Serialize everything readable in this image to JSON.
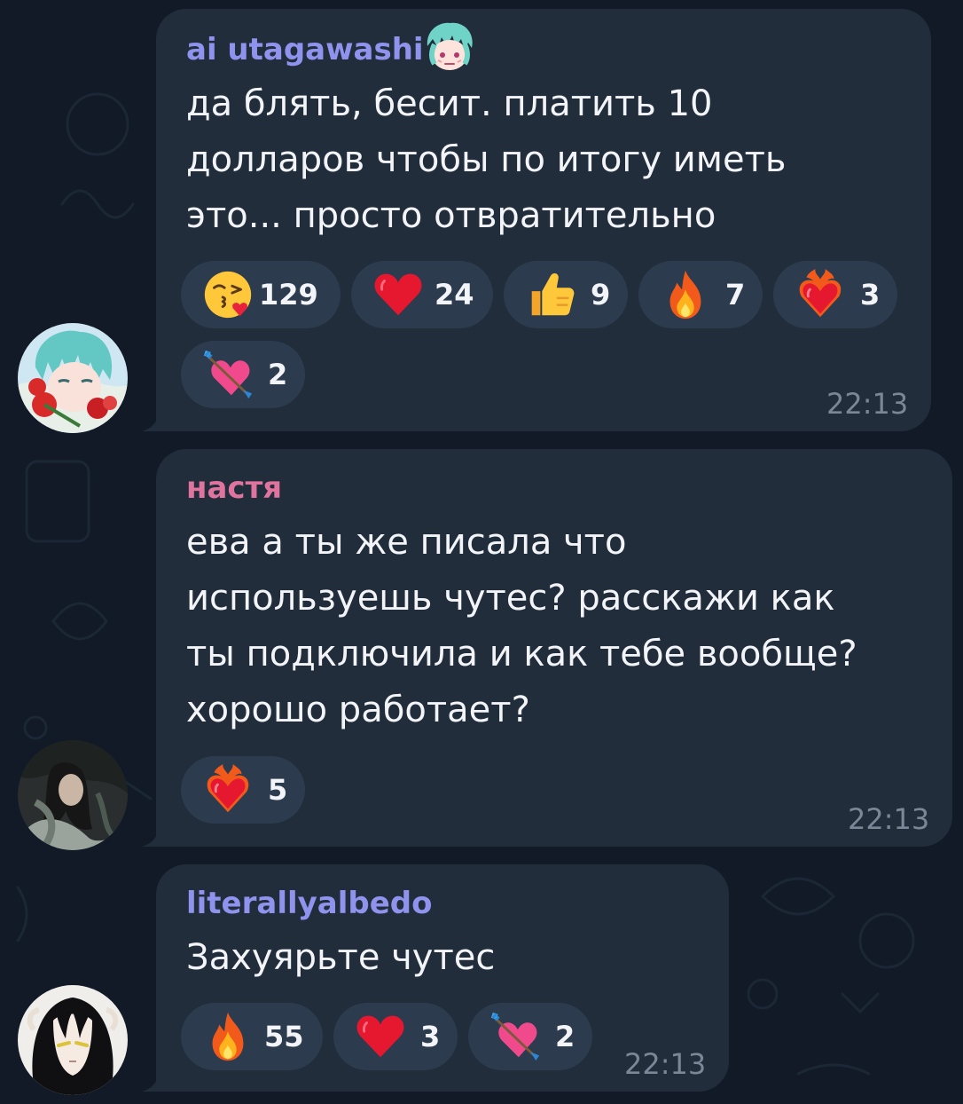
{
  "colors": {
    "background": "#111a26",
    "bubble": "#212d3b",
    "reaction_pill": "#2c3b4e",
    "timestamp": "#7b8796",
    "sender_1": "#8f93ee",
    "sender_2": "#e0749e",
    "sender_3": "#8f93ee"
  },
  "messages": [
    {
      "sender": "ai utagawashi",
      "sender_emoji_icon": "anime-avatar-emoji-icon",
      "lines": [
        "да блять, бесит. платить 10",
        "долларов чтобы по итогу иметь",
        "это... просто отвратительно"
      ],
      "reactions": [
        {
          "icon": "kissing-heart-emoji-icon",
          "count": "129"
        },
        {
          "icon": "red-heart-emoji-icon",
          "count": "24"
        },
        {
          "icon": "thumbs-up-emoji-icon",
          "count": "9"
        },
        {
          "icon": "fire-emoji-icon",
          "count": "7"
        },
        {
          "icon": "heart-on-fire-emoji-icon",
          "count": "3"
        },
        {
          "icon": "heart-with-arrow-emoji-icon",
          "count": "2"
        }
      ],
      "time": "22:13"
    },
    {
      "sender": "настя",
      "lines": [
        "ева а ты же писала что",
        "используешь чутес? расскажи как",
        "ты подключила и как тебе вообще?",
        "хорошо работает?"
      ],
      "reactions": [
        {
          "icon": "heart-on-fire-emoji-icon",
          "count": "5"
        }
      ],
      "time": "22:13"
    },
    {
      "sender": "literallyalbedo",
      "lines": [
        "Захуярьте чутес"
      ],
      "reactions": [
        {
          "icon": "fire-emoji-icon",
          "count": "55"
        },
        {
          "icon": "red-heart-emoji-icon",
          "count": "3"
        },
        {
          "icon": "heart-with-arrow-emoji-icon",
          "count": "2"
        }
      ],
      "time": "22:13"
    }
  ]
}
